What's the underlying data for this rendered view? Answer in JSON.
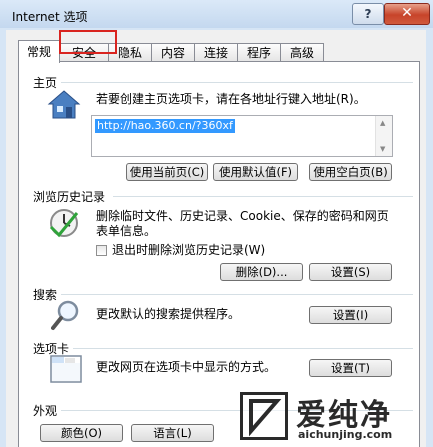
{
  "window": {
    "title": "Internet 选项",
    "help_label": "?",
    "close_label": "✕"
  },
  "tabs": [
    {
      "label": "常规",
      "active": true
    },
    {
      "label": "安全",
      "highlighted": true
    },
    {
      "label": "隐私"
    },
    {
      "label": "内容"
    },
    {
      "label": "连接"
    },
    {
      "label": "程序"
    },
    {
      "label": "高级"
    }
  ],
  "homepage": {
    "label": "主页",
    "description": "若要创建主页选项卡，请在各地址行键入地址(R)。",
    "url": "http://hao.360.cn/?360xf",
    "buttons": {
      "use_current": "使用当前页(C)",
      "use_default": "使用默认值(F)",
      "use_blank": "使用空白页(B)"
    }
  },
  "history": {
    "label": "浏览历史记录",
    "description_line1": "删除临时文件、历史记录、Cookie、保存的密码和网页",
    "description_line2": "表单信息。",
    "checkbox_label": "退出时删除浏览历史记录(W)",
    "checkbox_checked": false,
    "delete_button": "删除(D)...",
    "settings_button": "设置(S)"
  },
  "search": {
    "label": "搜索",
    "description": "更改默认的搜索提供程序。",
    "settings_button": "设置(I)"
  },
  "tabs_section": {
    "label": "选项卡",
    "description": "更改网页在选项卡中显示的方式。",
    "settings_button": "设置(T)"
  },
  "appearance": {
    "label": "外观",
    "colors_button": "颜色(O)",
    "languages_button": "语言(L)"
  },
  "watermark": {
    "text_big": "爱纯净",
    "text_small": "aichunjing.com"
  }
}
